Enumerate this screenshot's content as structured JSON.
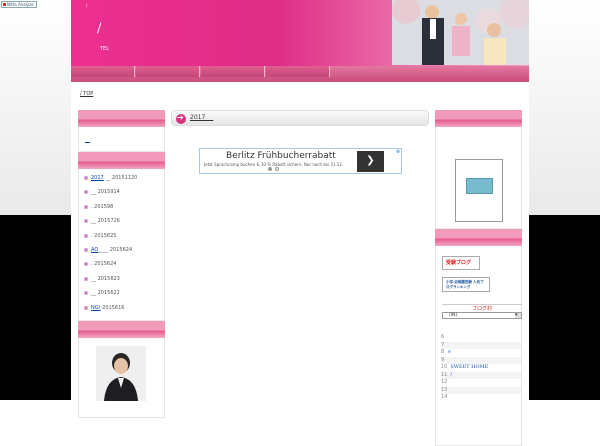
{
  "analyze_badge": "Nitta Analyze",
  "header": {
    "tiny_text": "/",
    "title": "/",
    "tel": "TEL"
  },
  "breadcrumb": "/ TOP",
  "left_sidebar": {
    "link": "__",
    "entries": [
      {
        "link": "2017",
        "rest": "__ 20151120"
      },
      {
        "link": "",
        "rest": "__ 2015914"
      },
      {
        "link": "",
        "rest": ". 201598"
      },
      {
        "link": "",
        "rest": "__ 2015726"
      },
      {
        "link": "",
        "rest": ". 2015625"
      },
      {
        "link": "AO",
        "rest": "____ 2015624"
      },
      {
        "link": "",
        "rest": ". 2015624"
      },
      {
        "link": "",
        "rest": "__ 2015623"
      },
      {
        "link": "",
        "rest": "__ 2015622"
      },
      {
        "link": "NG!",
        "rest": "2015616"
      }
    ]
  },
  "main": {
    "post_title": "2017 __",
    "ad": {
      "title": "Berlitz Frühbucherrabatt",
      "subtitle": "Jetzt Sprachcamp buchen & 10 % Rabatt sichern. Nur noch bis 31.12.",
      "go": "❯",
      "close": "⊗"
    }
  },
  "right_sidebar": {
    "badge1": "受験ブログ",
    "badge2": "小学·幼稚園受験 人気ブログランキング",
    "ranking_title": "ブログ村",
    "select_value": "(IN)",
    "rows": [
      {
        "num": "6",
        "text": ""
      },
      {
        "num": "7",
        "text": ""
      },
      {
        "num": "8",
        "text": "×"
      },
      {
        "num": "9",
        "text": ""
      },
      {
        "num": "10",
        "text": "SWEET HOME"
      },
      {
        "num": "11",
        "text": "/"
      },
      {
        "num": "12",
        "text": ""
      },
      {
        "num": "13",
        "text": ""
      },
      {
        "num": "14",
        "text": ""
      }
    ]
  },
  "colors": {
    "header_pink": "#ee2f8f",
    "nav_pink": "#d45a8a",
    "link_blue": "#0645ad"
  }
}
